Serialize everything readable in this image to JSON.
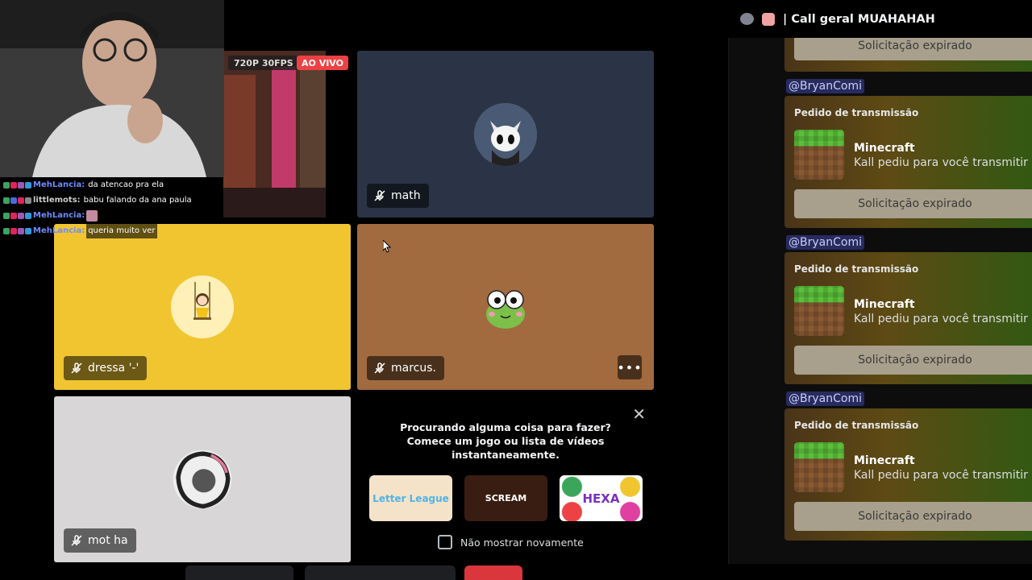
{
  "stream_overlay": {
    "resolution_badge": "720P 30FPS",
    "live_badge": "AO VIVO",
    "chat": [
      {
        "user": "MehLancia:",
        "message": "da atencao pra ela"
      },
      {
        "user": "littlemots:",
        "message": "babu falando da ana paula"
      },
      {
        "user": "MehLancia:",
        "message": ""
      },
      {
        "user": "MehLancia:",
        "message": "queria muito ver"
      }
    ]
  },
  "participants": [
    {
      "name": "math",
      "bg": "#2b3446"
    },
    {
      "name": "dressa '-'",
      "bg": "#f0c530"
    },
    {
      "name": "marcus.",
      "bg": "#a26a3f"
    },
    {
      "name": "mot ha",
      "bg": "#d8d6d6"
    }
  ],
  "activity": {
    "prompt_line1": "Procurando alguma coisa para fazer?",
    "prompt_line2": "Comece um jogo ou lista de vídeos",
    "prompt_line3": "instantaneamente.",
    "games": [
      {
        "label": "Letter League",
        "bg": "#f4e3c8"
      },
      {
        "label": "SCREAM",
        "bg": "#3a1d12"
      },
      {
        "label": "HEXA",
        "bg": "#ffffff"
      }
    ],
    "dont_show": "Não mostrar novamente"
  },
  "chat_panel": {
    "header_title": "| Call geral MUAHAHAH",
    "first_status": "Solicitação expirado",
    "requests": [
      {
        "mention": "@BryanComi",
        "title": "Pedido de transmissão",
        "game": "Minecraft",
        "desc": "Kall pediu para você transmitir",
        "status": "Solicitação expirado"
      },
      {
        "mention": "@BryanComi",
        "title": "Pedido de transmissão",
        "game": "Minecraft",
        "desc": "Kall pediu para você transmitir",
        "status": "Solicitação expirado"
      },
      {
        "mention": "@BryanComi",
        "title": "Pedido de transmissão",
        "game": "Minecraft",
        "desc": "Kall pediu para você transmitir",
        "status": "Solicitação expirado"
      }
    ]
  },
  "colors": {
    "live": "#ed4245",
    "mention_bg": "#5865f2",
    "embed_button": "#a8a08c"
  }
}
